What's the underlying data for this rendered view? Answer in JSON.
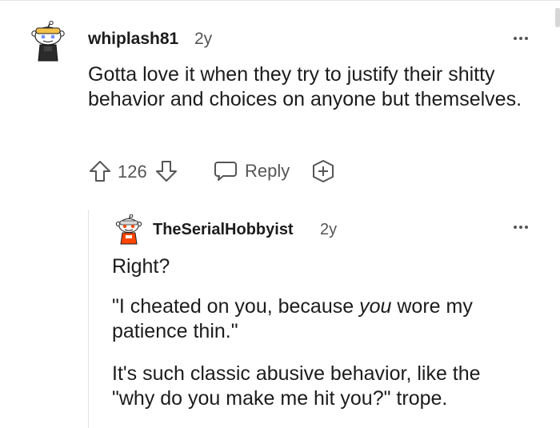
{
  "comment": {
    "username": "whiplash81",
    "age": "2y",
    "body": "Gotta love it when they try to justify their shitty behavior and choices on anyone but themselves.",
    "score": "126",
    "reply_label": "Reply"
  },
  "reply": {
    "username": "TheSerialHobbyist",
    "age": "2y",
    "paragraph1": "Right?",
    "paragraph2_before": "\"I cheated on you, because ",
    "paragraph2_em": "you",
    "paragraph2_after": " wore my patience thin.\"",
    "paragraph3": "It's such classic abusive behavior, like the \"why do you make me hit you?\" trope."
  },
  "colors": {
    "text": "#1c1c1c",
    "meta": "#555555",
    "avatar_blue": "#7193ff",
    "avatar_orange": "#ff4500"
  }
}
